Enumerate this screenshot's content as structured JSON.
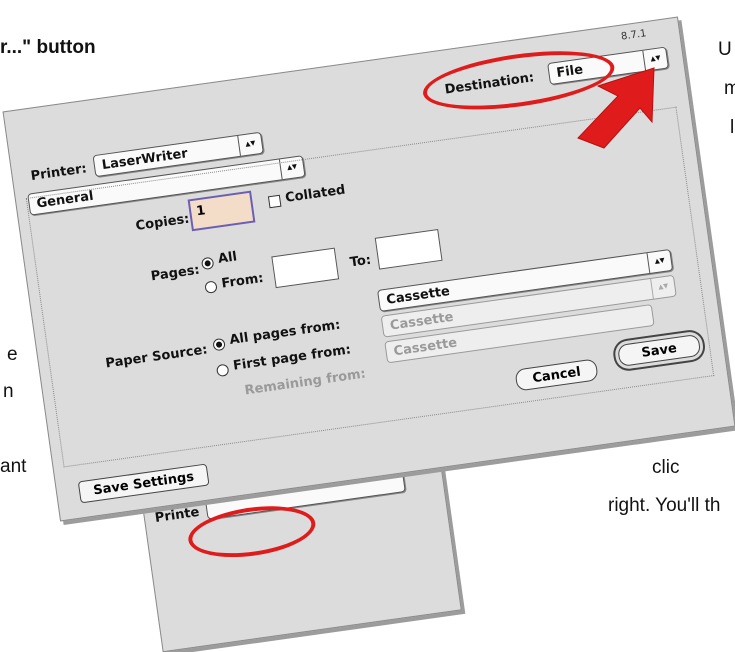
{
  "doc": {
    "top_left": "r...\" button",
    "right_lines": [
      "U",
      "m",
      "l"
    ],
    "left_lines": [
      "e",
      "n",
      "ant"
    ],
    "bottom_right_1": "clic",
    "bottom_right_2": "right. You'll th"
  },
  "dialog": {
    "version": "8.7.1",
    "destination_label": "Destination:",
    "destination_value": "File",
    "printer_label": "Printer:",
    "printer_value": "LaserWriter",
    "panel_value": "General",
    "copies_label": "Copies:",
    "copies_value": "1",
    "collated_label": "Collated",
    "pages_label": "Pages:",
    "pages_all": "All",
    "pages_from": "From:",
    "pages_to": "To:",
    "paper_source_label": "Paper Source:",
    "all_pages_from": "All pages from:",
    "first_page_from": "First page from:",
    "remaining_from": "Remaining from:",
    "cassette_1": "Cassette",
    "cassette_2": "Cassette",
    "cassette_3": "Cassette",
    "cancel": "Cancel",
    "save": "Save",
    "save_settings": "Save Settings"
  },
  "back_dialog": {
    "printer_label": "Printe"
  },
  "colors": {
    "highlight": "#e01b1b",
    "copies_field": "#f3dcc8"
  }
}
